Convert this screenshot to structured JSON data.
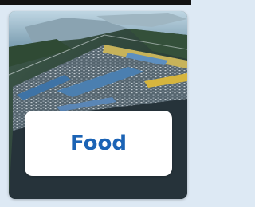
{
  "category_card": {
    "label": "Food",
    "image": "aerial-market-complex-photo"
  },
  "colors": {
    "label_text": "#1b63b5",
    "label_background": "#ffffff",
    "page_background": "#dde9f4"
  }
}
